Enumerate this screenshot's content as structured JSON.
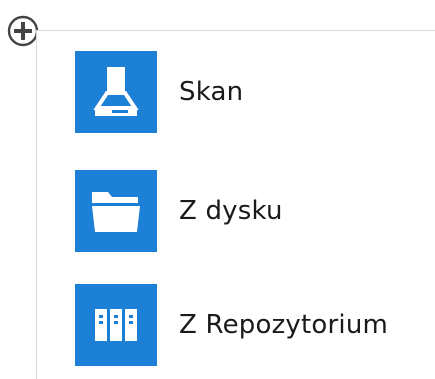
{
  "add_button": {
    "icon": "plus-circle-icon"
  },
  "menu": {
    "accent_color": "#1b80d6",
    "items": [
      {
        "label": "Skan",
        "icon": "scanner-icon"
      },
      {
        "label": "Z dysku",
        "icon": "folder-icon"
      },
      {
        "label": "Z Repozytorium",
        "icon": "binders-icon"
      }
    ]
  }
}
